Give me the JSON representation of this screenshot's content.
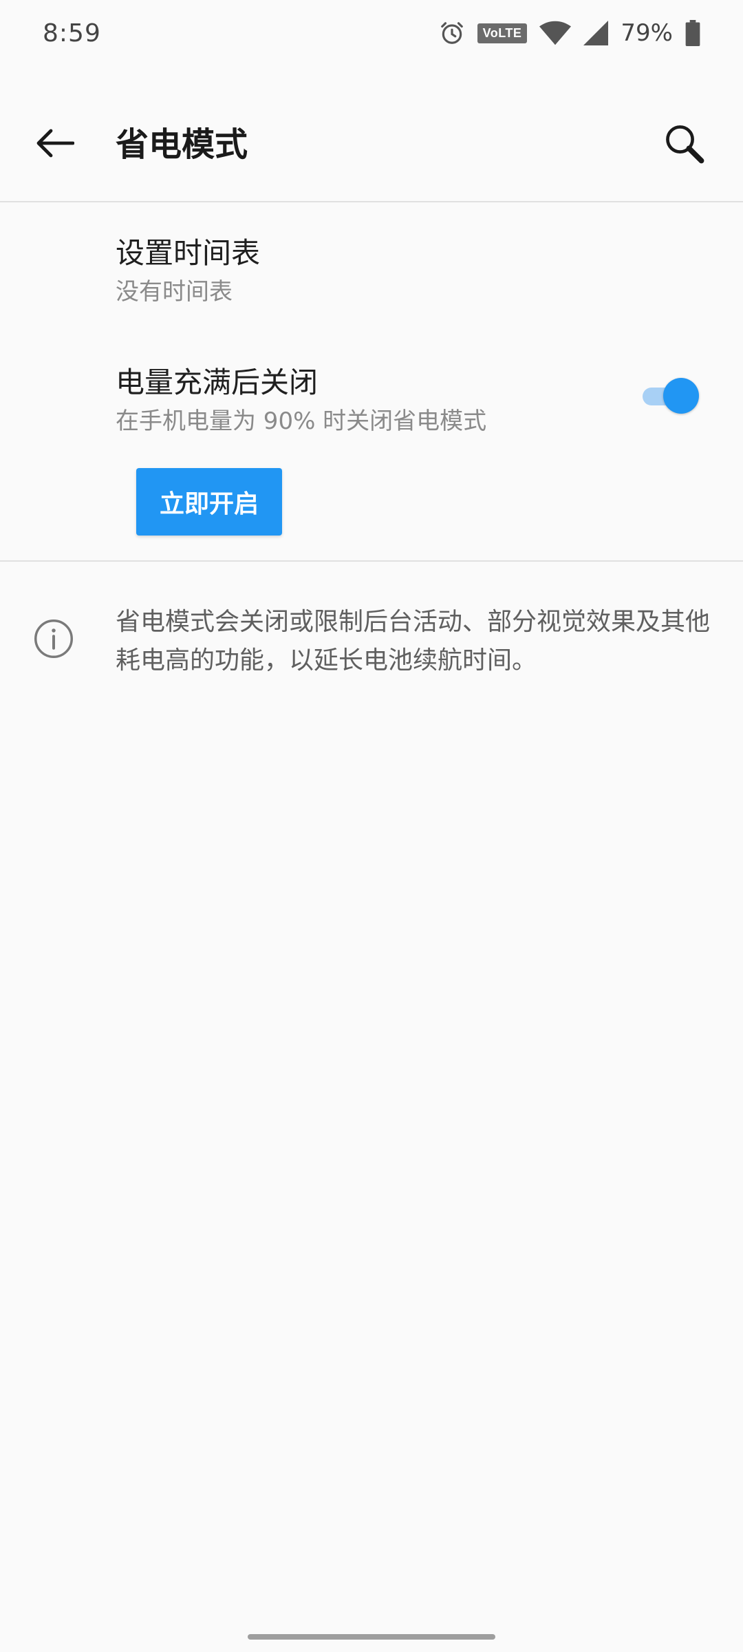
{
  "status_bar": {
    "time": "8:59",
    "volte": "VoLTE",
    "battery_percent": "79%",
    "icons": [
      "alarm-icon",
      "volte-icon",
      "wifi-icon",
      "signal-icon",
      "battery-icon"
    ]
  },
  "app_bar": {
    "title": "省电模式",
    "back_icon": "arrow-left-icon",
    "search_icon": "search-icon"
  },
  "settings": {
    "schedule": {
      "title": "设置时间表",
      "summary": "没有时间表"
    },
    "turn_off_when_charged": {
      "title": "电量充满后关闭",
      "summary": "在手机电量为 90% 时关闭省电模式",
      "enabled": true
    }
  },
  "actions": {
    "turn_on_now": "立即开启"
  },
  "info": {
    "icon": "info-icon",
    "text": "省电模式会关闭或限制后台活动、部分视觉效果及其他耗电高的功能，以延长电池续航时间。"
  },
  "colors": {
    "accent": "#2196f3",
    "toggle_track": "#a8d0f5",
    "background": "#fafafa"
  }
}
